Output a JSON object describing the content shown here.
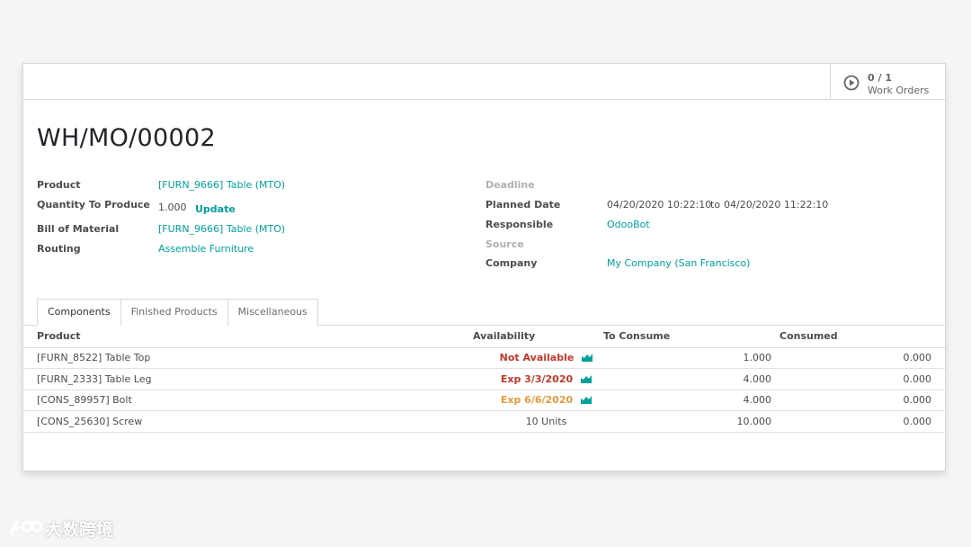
{
  "smart_button": {
    "value": "0 / 1",
    "label": "Work Orders"
  },
  "record": {
    "title": "WH/MO/00002"
  },
  "left_fields": {
    "product": {
      "label": "Product",
      "value": "[FURN_9666] Table (MTO)"
    },
    "quantity": {
      "label": "Quantity To Produce",
      "value": "1.000",
      "update_label": "Update"
    },
    "bom": {
      "label": "Bill of Material",
      "value": "[FURN_9666] Table (MTO)"
    },
    "routing": {
      "label": "Routing",
      "value": "Assemble Furniture"
    }
  },
  "right_fields": {
    "deadline": {
      "label": "Deadline",
      "value": ""
    },
    "planned_date": {
      "label": "Planned Date",
      "start": "04/20/2020 10:22:10",
      "sep": "to",
      "end": "04/20/2020 11:22:10"
    },
    "responsible": {
      "label": "Responsible",
      "value": "OdooBot"
    },
    "source": {
      "label": "Source",
      "value": ""
    },
    "company": {
      "label": "Company",
      "value": "My Company (San Francisco)"
    }
  },
  "tabs": [
    {
      "label": "Components",
      "active": true
    },
    {
      "label": "Finished Products",
      "active": false
    },
    {
      "label": "Miscellaneous",
      "active": false
    }
  ],
  "table": {
    "headers": {
      "product": "Product",
      "availability": "Availability",
      "to_consume": "To Consume",
      "consumed": "Consumed"
    },
    "rows": [
      {
        "product": "[FURN_8522] Table Top",
        "availability": "Not Available",
        "status": "red",
        "to_consume": "1.000",
        "consumed": "0.000"
      },
      {
        "product": "[FURN_2333] Table Leg",
        "availability": "Exp 3/3/2020",
        "status": "red",
        "to_consume": "4.000",
        "consumed": "0.000"
      },
      {
        "product": "[CONS_89957] Bolt",
        "availability": "Exp 6/6/2020",
        "status": "orange",
        "to_consume": "4.000",
        "consumed": "0.000"
      },
      {
        "product": "[CONS_25630] Screw",
        "availability": "10 Units",
        "status": "none",
        "to_consume": "10.000",
        "consumed": "0.000"
      }
    ]
  },
  "colors": {
    "link": "#00a09d",
    "danger": "#c0392b",
    "warning": "#e59a3b"
  },
  "icons": {
    "smart_button": "play-circle-icon",
    "forecast": "area-chart-icon"
  },
  "watermark": {
    "text": "大数跨境"
  }
}
